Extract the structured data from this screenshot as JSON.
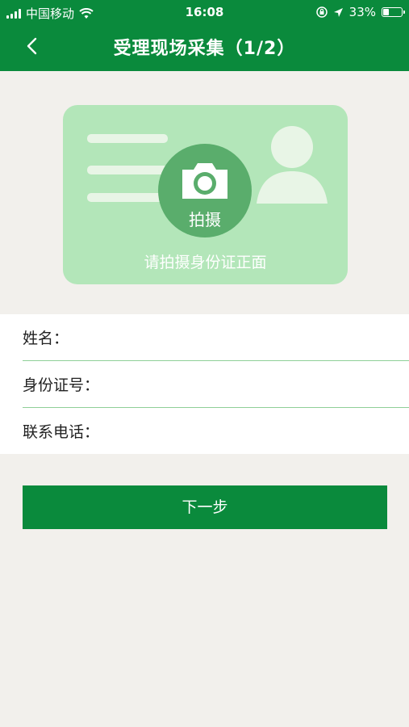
{
  "status_bar": {
    "carrier": "中国移动",
    "time": "16:08",
    "battery": "33%",
    "battery_level": 0.33,
    "icons": [
      "signal-icon",
      "wifi-icon",
      "orientation-lock-icon",
      "location-arrow-icon",
      "battery-icon"
    ]
  },
  "nav": {
    "back_icon": "chevron-left-icon",
    "title": "受理现场采集（1/2）"
  },
  "id_card": {
    "camera_icon": "camera-icon",
    "camera_label": "拍摄",
    "hint": "请拍摄身份证正面",
    "avatar_icon": "person-silhouette-icon"
  },
  "form": {
    "name_label": "姓名：",
    "name_value": "",
    "id_label": "身份证号：",
    "id_value": "",
    "phone_label": "联系电话：",
    "phone_value": ""
  },
  "next_button": "下一步",
  "colors": {
    "primary": "#0a8a3c",
    "card_bg": "#b3e6b9",
    "camera_circle": "#5aad6c",
    "page_bg": "#f2f0ec"
  }
}
